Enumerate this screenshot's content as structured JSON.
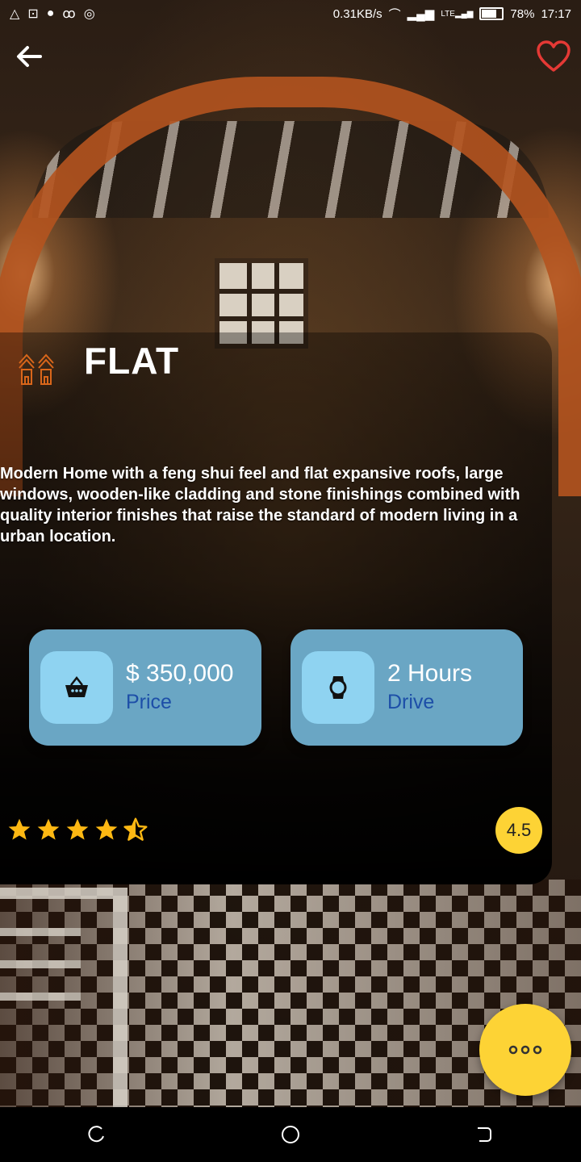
{
  "status_bar": {
    "network_speed": "0.31KB/s",
    "battery": "78%",
    "time": "17:17",
    "lte": "LTE"
  },
  "header": {
    "back_icon": "arrow-left-icon",
    "favorite_icon": "heart-outline-icon",
    "favorite_color": "#e53935"
  },
  "property": {
    "category_icon": "houses-icon",
    "title": "FLAT",
    "description": "Modern Home with a feng shui feel and flat expansive roofs, large windows, wooden-like cladding and stone finishings combined with quality interior finishes that raise the standard of modern living in a urban location."
  },
  "stats": [
    {
      "icon": "shopping-basket-icon",
      "value": "$ 350,000",
      "label": "Price"
    },
    {
      "icon": "watch-icon",
      "value": "2 Hours",
      "label": "Drive"
    }
  ],
  "rating": {
    "stars": 4.5,
    "max": 5,
    "value_text": "4.5",
    "star_color": "#fdb813"
  },
  "fab": {
    "icon": "more-horizontal-icon",
    "color": "#fdd335"
  },
  "nav": {
    "recent_icon": "recent-apps-icon",
    "home_icon": "home-circle-icon",
    "back_icon": "nav-back-icon"
  }
}
